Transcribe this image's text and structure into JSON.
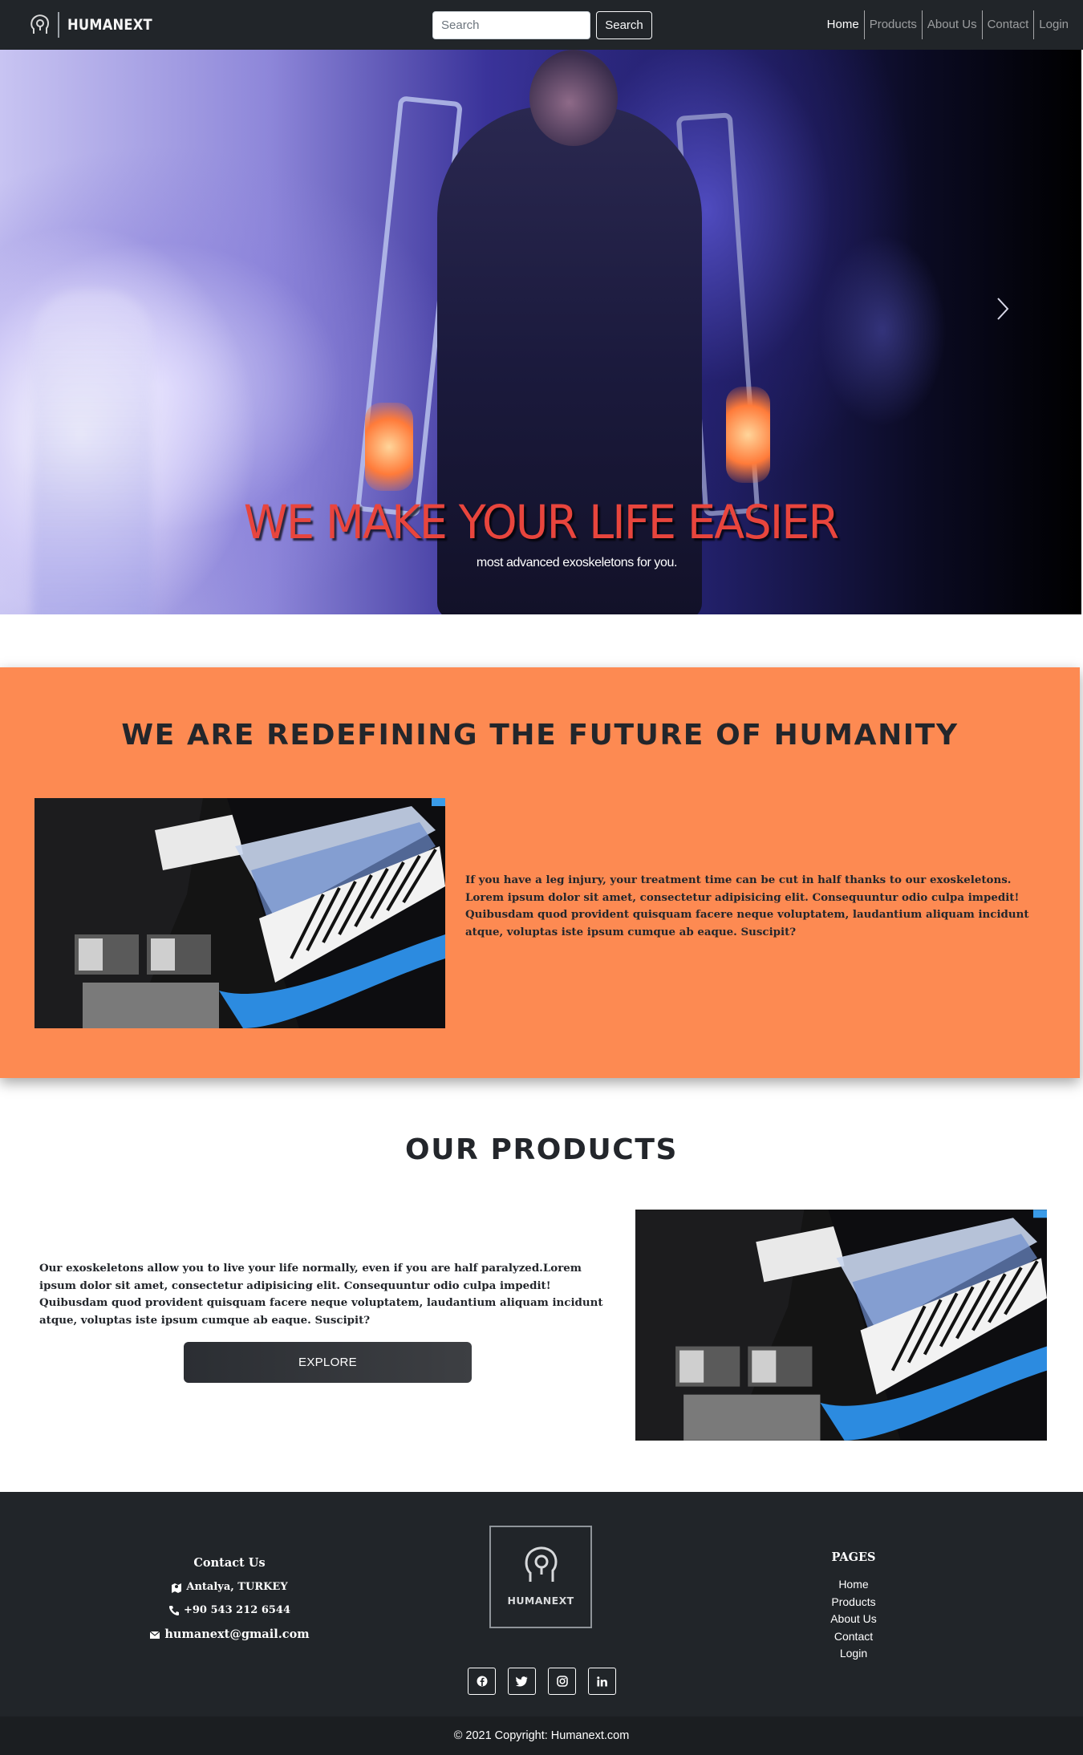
{
  "navbar": {
    "brand": "HUMANEXT",
    "search_placeholder": "Search",
    "search_button": "Search",
    "links": [
      "Home",
      "Products",
      "About Us",
      "Contact",
      "Login"
    ],
    "active_link": "Home"
  },
  "hero": {
    "title": "WE MAKE YOUR LIFE EASIER",
    "subtitle": "most advanced exoskeletons for you.",
    "next_icon": "chevron-right-icon"
  },
  "about": {
    "heading": "WE ARE REDEFINING THE FUTURE OF HUMANITY",
    "text": "If you have a leg injury, your treatment time can be cut in half thanks to our exoskeletons. Lorem ipsum dolor sit amet, consectetur adipisicing elit. Consequuntur odio culpa impedit! Quibusdam quod provident quisquam facere neque voluptatem, laudantium aliquam incidunt atque, voluptas iste ipsum cumque ab eaque. Suscipit?"
  },
  "products": {
    "heading": "OUR PRODUCTS",
    "text": "Our exoskeletons allow you to live your life normally, even if you are half paralyzed.Lorem ipsum dolor sit amet, consectetur adipisicing elit. Consequuntur odio culpa impedit! Quibusdam quod provident quisquam facere neque voluptatem, laudantium aliquam incidunt atque, voluptas iste ipsum cumque ab eaque. Suscipit?",
    "button": "EXPLORE"
  },
  "footer": {
    "contact": {
      "title": "Contact Us",
      "address": "Antalya, TURKEY",
      "phone": "+90 543 212 6544",
      "email": "humanext@gmail.com"
    },
    "logo_text": "HUMANEXT",
    "social": [
      "facebook-icon",
      "twitter-icon",
      "instagram-icon",
      "linkedin-icon"
    ],
    "pages": {
      "title": "PAGES",
      "links": [
        "Home",
        "Products",
        "About Us",
        "Contact",
        "Login"
      ]
    },
    "copyright": "© 2021 Copyright: Humanext.com"
  },
  "colors": {
    "navbar_bg": "#212529",
    "accent_orange": "#fd8a52",
    "hero_title": "#e8453d",
    "footer_bg": "#212529"
  }
}
